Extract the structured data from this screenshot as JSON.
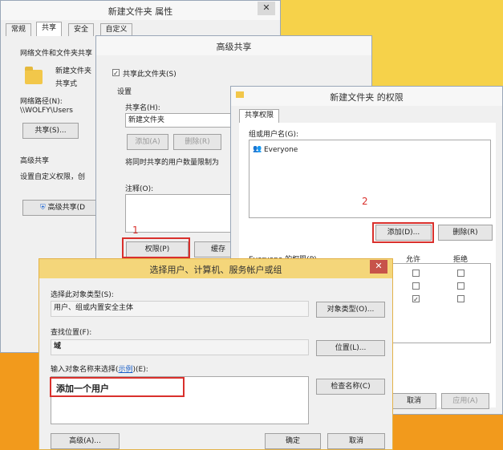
{
  "props": {
    "title": "新建文件夹 属性",
    "tabs": [
      "常规",
      "共享",
      "安全",
      "自定义"
    ],
    "net_file_share": "网络文件和文件夹共享",
    "folder_name": "新建文件夹",
    "share_state": "共享式",
    "net_path_label": "网络路径(N):",
    "net_path": "\\\\WOLFY\\Users",
    "share_btn": "共享(S)...",
    "adv_header": "高级共享",
    "adv_desc": "设置自定义权限，创",
    "adv_btn": "高级共享(D"
  },
  "adv": {
    "title": "高级共享",
    "share_check": "共享此文件夹(S)",
    "settings": "设置",
    "share_name_label": "共享名(H):",
    "share_name": "新建文件夹",
    "add": "添加(A)",
    "remove": "删除(R)",
    "limit": "将同时共享的用户数量限制为",
    "notes": "注释(O):",
    "permissions": "权限(P)",
    "cache": "缓存"
  },
  "perm": {
    "title": "新建文件夹 的权限",
    "tab": "共享权限",
    "group_label": "组或用户名(G):",
    "everyone": "Everyone",
    "add": "添加(D)...",
    "remove": "删除(R)",
    "perm_for": "Everyone 的权限(P)",
    "allow": "允许",
    "deny": "拒绝",
    "cancel": "取消",
    "apply": "应用(A)"
  },
  "sel": {
    "title": "选择用户、计算机、服务帐户或组",
    "obj_type_label": "选择此对象类型(S):",
    "obj_type": "用户、组或内置安全主体",
    "obj_type_btn": "对象类型(O)...",
    "location_label": "查找位置(F):",
    "location": "域",
    "location_btn": "位置(L)...",
    "enter_label_a": "输入对象名称来选择(",
    "enter_label_link": "示例",
    "enter_label_b": ")(E):",
    "enter_value": "添加一个用户",
    "check_btn": "检查名称(C)",
    "advanced_btn": "高级(A)...",
    "ok_btn": "确定",
    "cancel_btn": "取消"
  },
  "annotations": {
    "one": "1",
    "two": "2"
  }
}
